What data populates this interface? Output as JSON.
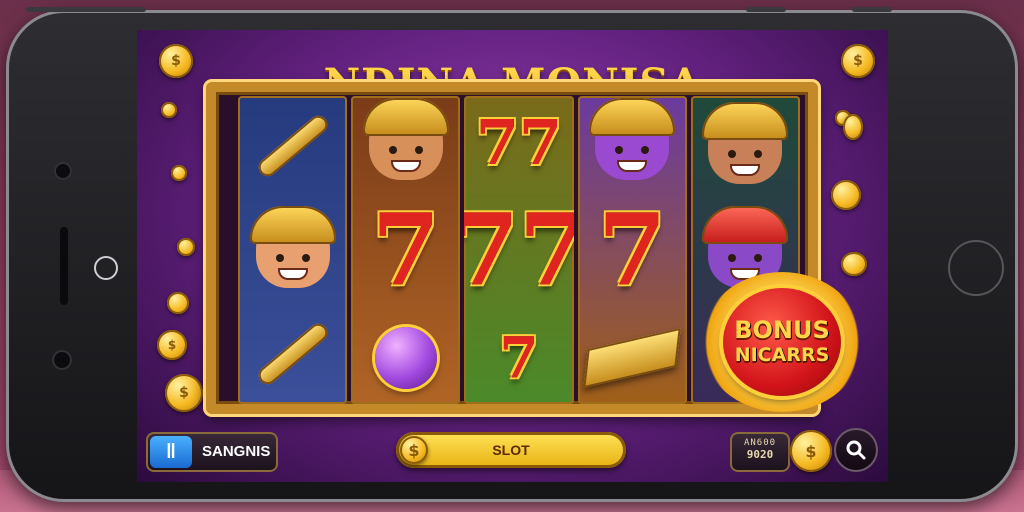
{
  "game": {
    "title": "NDINA MONISA",
    "bonus_line1": "BONUS",
    "bonus_line2": "NICARRS",
    "settings_label": "SANGNIS",
    "settings_icon": "pause-icon",
    "spin_label": "SLOT",
    "credit_top": "AN600",
    "credit_value": "9020",
    "search_icon": "search-icon"
  },
  "reels": [
    [
      "crossed-tools",
      "helmet-warrior",
      "crossed-bones"
    ],
    [
      "horned-warrior",
      "seven",
      "purple-orb"
    ],
    [
      "seven",
      "seven",
      "seven"
    ],
    [
      "purple-knight",
      "seven",
      "gold-bar"
    ],
    [
      "viking-woman",
      "purple-goddess",
      "bonus"
    ]
  ],
  "colors": {
    "title": "#ffd54a",
    "seven": "#e02420",
    "frame": "#c48a2a",
    "bonus": "#d2141a",
    "slot_button": "#ffe45a",
    "settings_icon_bg": "#1a6ad0"
  }
}
